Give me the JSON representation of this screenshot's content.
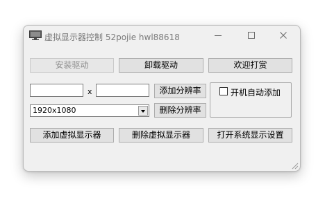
{
  "window": {
    "title": "虚拟显示器控制 52pojie hwl88618",
    "app_icon": "monitor-icon",
    "controls": [
      "minimize-icon",
      "maximize-icon",
      "close-icon"
    ]
  },
  "buttons": {
    "install_driver": "安装驱动",
    "uninstall_driver": "卸载驱动",
    "donate": "欢迎打赏",
    "add_resolution": "添加分辨率",
    "delete_resolution": "删除分辨率",
    "add_virtual_display": "添加虚拟显示器",
    "delete_virtual_display": "删除虚拟显示器",
    "open_display_settings": "打开系统显示设置"
  },
  "resolution": {
    "width_value": "",
    "separator": "x",
    "height_value": "",
    "selected": "1920x1080"
  },
  "autostart": {
    "label": "开机自动添加",
    "checked": false
  }
}
